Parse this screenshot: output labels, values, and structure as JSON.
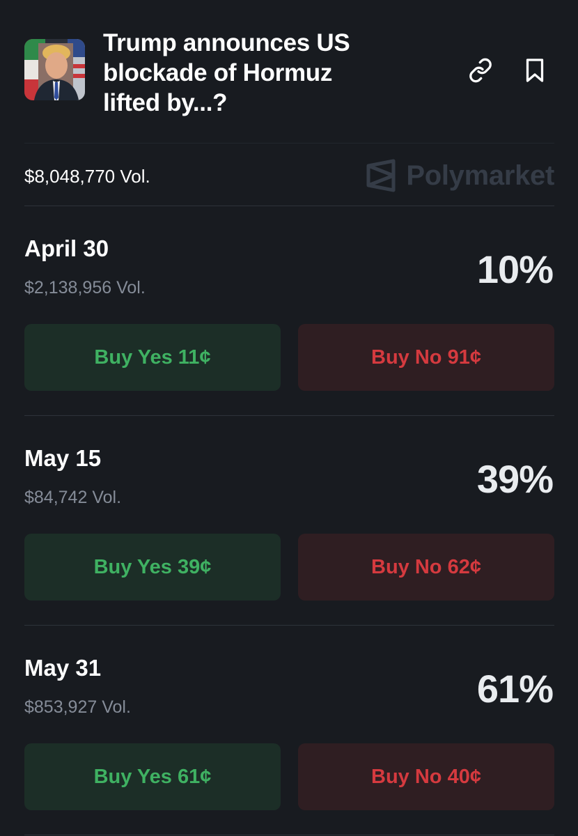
{
  "market": {
    "title": "Trump announces US blockade of Hormuz lifted by...?",
    "total_volume": "$8,048,770 Vol.",
    "brand": "Polymarket",
    "icons": {
      "link": "link-icon",
      "bookmark": "bookmark-icon",
      "brand": "polymarket-logo-icon"
    }
  },
  "outcomes": [
    {
      "date": "April 30",
      "volume": "$2,138,956 Vol.",
      "percent": "10%",
      "buy_yes": "Buy Yes 11¢",
      "buy_no": "Buy No 91¢"
    },
    {
      "date": "May 15",
      "volume": "$84,742 Vol.",
      "percent": "39%",
      "buy_yes": "Buy Yes 39¢",
      "buy_no": "Buy No 62¢"
    },
    {
      "date": "May 31",
      "volume": "$853,927 Vol.",
      "percent": "61%",
      "buy_yes": "Buy Yes 61¢",
      "buy_no": "Buy No 40¢"
    }
  ],
  "colors": {
    "background": "#181b20",
    "yes_text": "#3fb162",
    "yes_bg": "#1c2e27",
    "no_text": "#d53a3f",
    "no_bg": "#2f1e22",
    "muted": "#858c98"
  }
}
